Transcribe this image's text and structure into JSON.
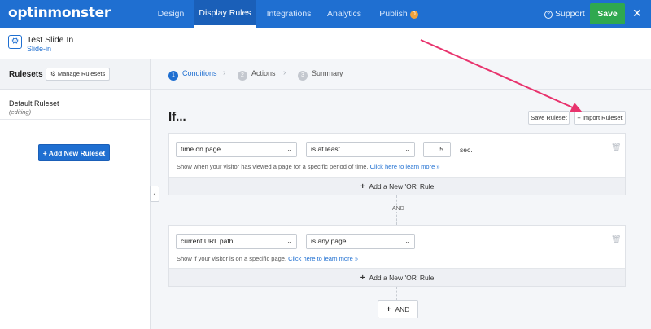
{
  "brand": {
    "logo_text": "optinmonster"
  },
  "nav": {
    "tabs": [
      {
        "label": "Design"
      },
      {
        "label": "Display Rules"
      },
      {
        "label": "Integrations"
      },
      {
        "label": "Analytics"
      },
      {
        "label": "Publish"
      }
    ],
    "publish_badge": "0",
    "support_label": "Support",
    "save_label": "Save",
    "close_glyph": "✕"
  },
  "campaign": {
    "title": "Test Slide In",
    "type": "Slide-in"
  },
  "sidebar": {
    "title": "Rulesets",
    "manage_label": "Manage Rulesets",
    "rulesets": [
      {
        "name": "Default Ruleset",
        "status": "(editing)"
      }
    ],
    "add_label": "Add New Ruleset"
  },
  "steps": [
    {
      "num": "1",
      "label": "Conditions"
    },
    {
      "num": "2",
      "label": "Actions"
    },
    {
      "num": "3",
      "label": "Summary"
    }
  ],
  "main": {
    "heading": "If...",
    "save_ruleset_label": "Save Ruleset",
    "import_ruleset_label": "Import Ruleset",
    "groups": [
      {
        "condition": "time on page",
        "operator": "is at least",
        "value": "5",
        "unit": "sec.",
        "help_text": "Show when your visitor has viewed a page for a specific period of time.",
        "help_link": "Click here to learn more »",
        "or_label": "Add a New 'OR' Rule"
      },
      {
        "condition": "current URL path",
        "operator": "is any page",
        "help_text": "Show if your visitor is on a specific page.",
        "help_link": "Click here to learn more »",
        "or_label": "Add a New 'OR' Rule"
      }
    ],
    "and_label": "AND",
    "and_button_label": "AND"
  },
  "colors": {
    "brand_blue": "#1f6fd1",
    "save_green": "#2fa84f",
    "annotation_arrow": "#e8336d"
  }
}
